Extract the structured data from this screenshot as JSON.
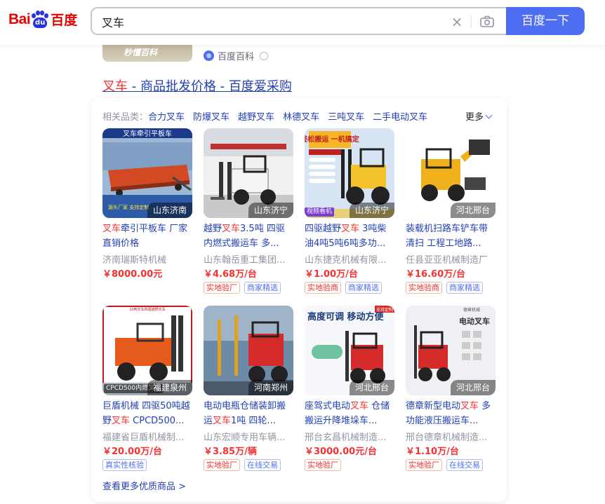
{
  "header": {
    "logo_bai": "Bai",
    "logo_du": "du",
    "logo_zh": "百度",
    "query": "叉车",
    "search_button": "百度一下"
  },
  "prev_result": {
    "image_text": "秒懂百科",
    "source": "百度百科"
  },
  "result": {
    "title_highlight": "叉车",
    "title_rest": " - 商品批发价格 - 百度爱采购"
  },
  "categories": {
    "label": "相关品类：",
    "items": [
      "合力叉车",
      "防爆叉车",
      "越野叉车",
      "林德叉车",
      "三吨叉车",
      "二手电动叉车"
    ],
    "more": "更多"
  },
  "products": [
    {
      "name_pre": "",
      "name_hl": "叉车",
      "name_post": "牵引平板车 厂家直销价格",
      "shop": "济南瑞斯特机械",
      "price": "￥8000.00元",
      "location": "山东济南",
      "overlay": "叉车牵引平板车",
      "video": "",
      "tags": []
    },
    {
      "name_pre": "越野",
      "name_hl": "叉车",
      "name_post": "3.5吨 四驱内燃式搬运车 多...",
      "shop": "山东翰岳重工集团...",
      "price": "￥4.68万/台",
      "location": "山东济宁",
      "overlay": "",
      "video": "",
      "tags": [
        {
          "text": "实地验厂",
          "color": "orange"
        },
        {
          "text": "商家精选",
          "color": "blue"
        }
      ]
    },
    {
      "name_pre": "四驱越野",
      "name_hl": "叉车",
      "name_post": " 3吨柴油4吨5吨6吨多功...",
      "shop": "山东捷克机械有限...",
      "price": "￥1.00万/台",
      "location": "山东济宁",
      "overlay": "轻松搬运 一机搞定",
      "video": "视频看机",
      "tags": [
        {
          "text": "实地验商",
          "color": "orange"
        },
        {
          "text": "商家精选",
          "color": "blue"
        }
      ]
    },
    {
      "name_pre": "装载机扫路车铲车带清扫 工程工地路...",
      "name_hl": "",
      "name_post": "",
      "shop": "任县亚亚机械制造厂",
      "price": "￥16.60万/台",
      "location": "河北邢台",
      "overlay": "",
      "video": "",
      "tags": [
        {
          "text": "实地验商",
          "color": "orange"
        },
        {
          "text": "商家精选",
          "color": "blue"
        }
      ]
    },
    {
      "name_pre": "巨盾机械 四驱50吨越野",
      "name_hl": "叉车",
      "name_post": " CPCD500...",
      "shop": "福建省巨盾机械制...",
      "price": "￥20.00万/台",
      "location": "福建泉州",
      "overlay": "CPCD500内燃叉车",
      "video": "",
      "tags": [
        {
          "text": "真实性核验",
          "color": "blue"
        }
      ]
    },
    {
      "name_pre": "电动电瓶仓储装卸搬运",
      "name_hl": "叉车",
      "name_post": "1吨 四轮...",
      "shop": "山东宏顺专用车辆...",
      "price": "￥3.85万/辆",
      "location": "河南郑州",
      "overlay": "",
      "video": "",
      "tags": [
        {
          "text": "实地验厂",
          "color": "orange"
        },
        {
          "text": "在线交易",
          "color": "blue"
        }
      ]
    },
    {
      "name_pre": "座驾式电动",
      "name_hl": "叉车",
      "name_post": " 仓储搬运升降堆垛车...",
      "shop": "邢台玄昌机械制造...",
      "price": "￥3000.00元/台",
      "location": "河北邢台",
      "overlay": "高度可调 移动方便",
      "video": "",
      "tags": [
        {
          "text": "实地验厂",
          "color": "orange"
        }
      ]
    },
    {
      "name_pre": "德章新型电动",
      "name_hl": "叉车",
      "name_post": " 多功能液压搬运车...",
      "shop": "邢台德章机械制造...",
      "price": "￥1.10万/台",
      "location": "河北邢台",
      "overlay": "电动叉车",
      "video": "",
      "tags": [
        {
          "text": "实地验厂",
          "color": "orange"
        },
        {
          "text": "在线交易",
          "color": "blue"
        }
      ]
    }
  ],
  "see_more": "查看更多优质商品 >"
}
